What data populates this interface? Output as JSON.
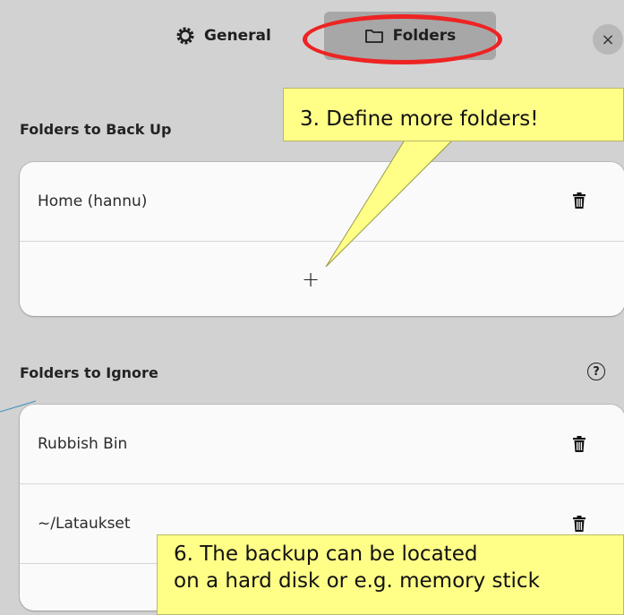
{
  "header": {
    "tabs": [
      {
        "label": "General",
        "icon": "gear-icon"
      },
      {
        "label": "Folders",
        "icon": "folder-icon",
        "selected": true
      }
    ],
    "close_label": "×"
  },
  "backup_section": {
    "title": "Folders to Back Up",
    "items": [
      {
        "label": "Home (hannu)",
        "icon": "trash-icon"
      }
    ],
    "add_label": "+"
  },
  "ignore_section": {
    "title": "Folders to Ignore",
    "help_icon": "help-icon",
    "help_label": "?",
    "items": [
      {
        "label": "Rubbish Bin",
        "icon": "trash-icon"
      },
      {
        "label": "~/Latauk­set",
        "icon": "trash-icon"
      }
    ]
  },
  "annotations": {
    "note3": "3. Define more folders!",
    "note6_line1": "6. The backup can be located",
    "note6_line2": "on a hard disk or e.g. memory stick"
  },
  "colors": {
    "background": "#d2d2d2",
    "selected_tab": "#a7a7a7",
    "highlight": "#ee2323",
    "note_fill": "#ffff88"
  }
}
